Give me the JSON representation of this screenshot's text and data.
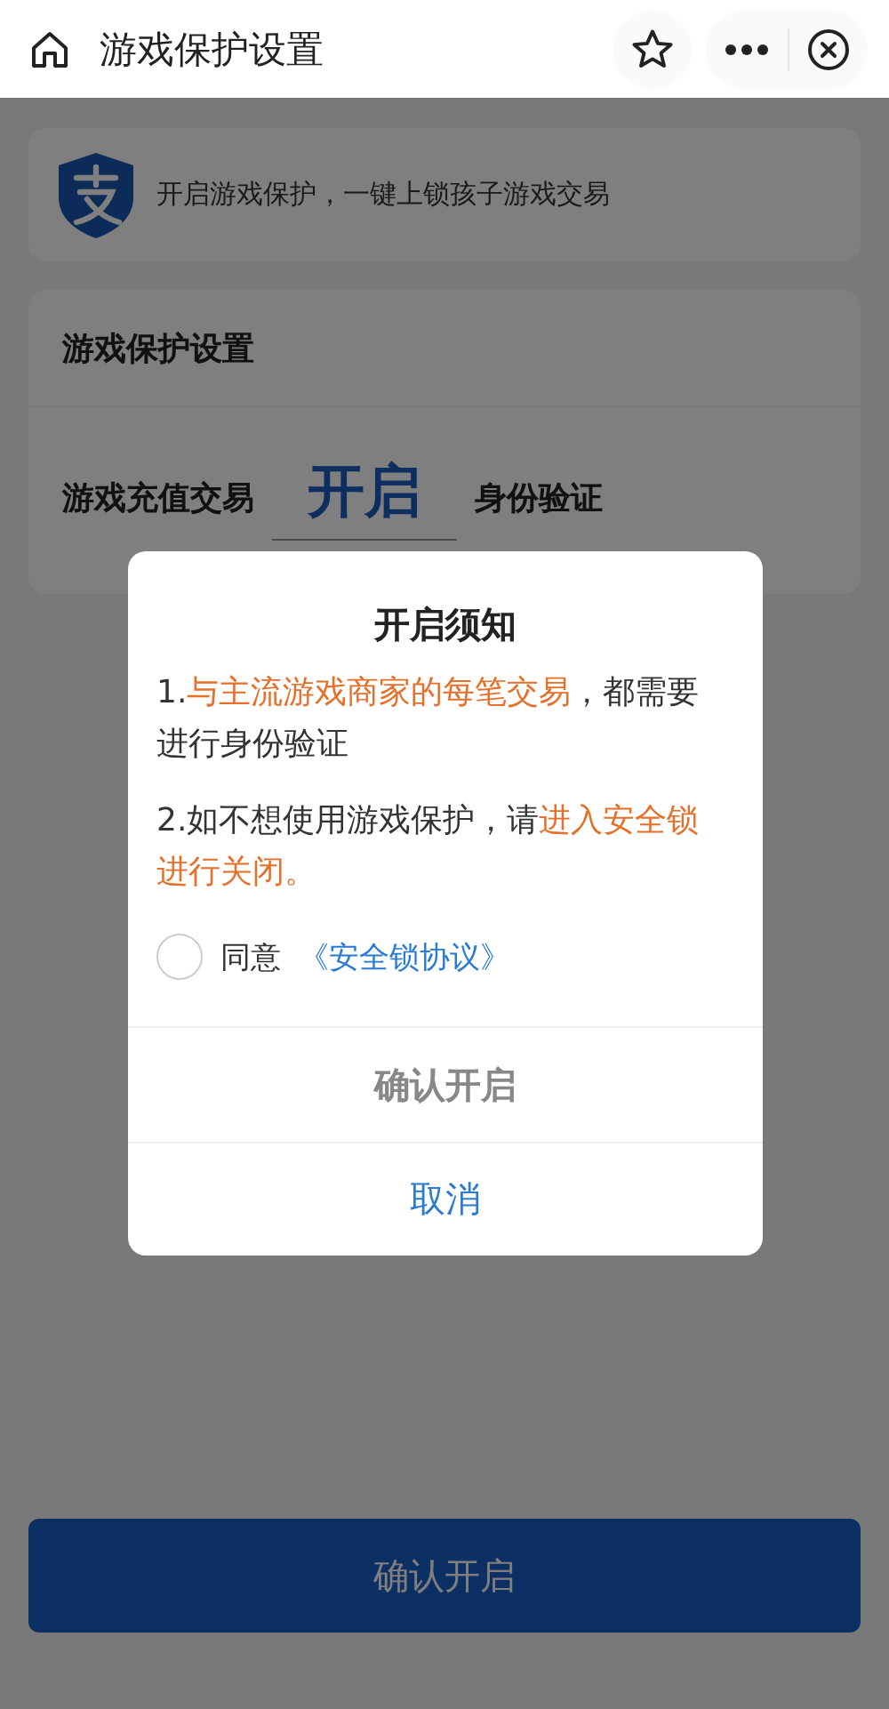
{
  "header": {
    "title": "游戏保护设置"
  },
  "banner": {
    "text": "开启游戏保护，一键上锁孩子游戏交易"
  },
  "settings": {
    "title": "游戏保护设置",
    "label": "游戏充值交易",
    "value": "开启",
    "label_2": "身份验证"
  },
  "bottom_button": {
    "label": "确认开启"
  },
  "dialog": {
    "title": "开启须知",
    "notices": [
      [
        {
          "text": "1.",
          "highlight": false
        },
        {
          "text": "与主流游戏商家的每笔交易",
          "highlight": true
        },
        {
          "text": "，都需要进行身份验证",
          "highlight": false
        }
      ],
      [
        {
          "text": "2.如不想使用游戏保护，请",
          "highlight": false
        },
        {
          "text": "进入安全锁进行关闭。",
          "highlight": true
        }
      ]
    ],
    "agreement": {
      "checked": false,
      "label": "同意",
      "link": "《安全锁协议》"
    },
    "confirm": {
      "label": "确认开启",
      "disabled": true
    },
    "cancel": {
      "label": "取消"
    }
  }
}
